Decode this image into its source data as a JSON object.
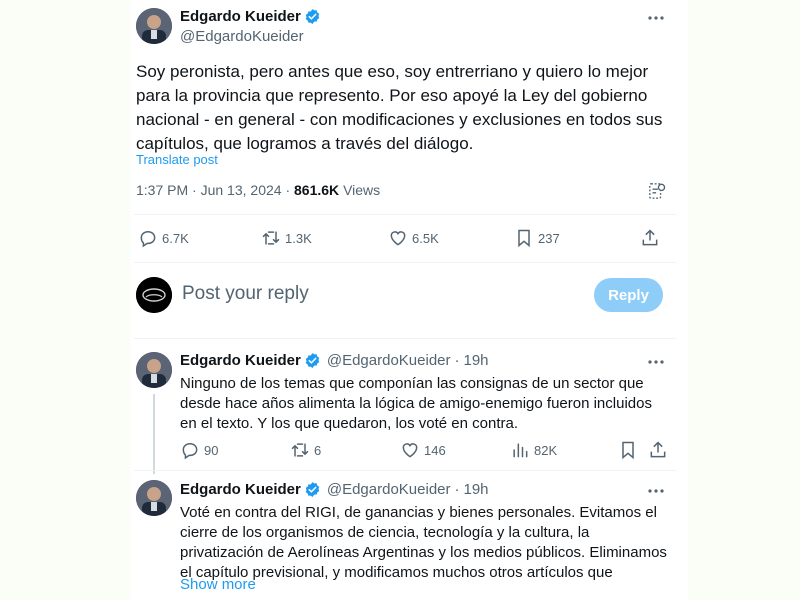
{
  "post": {
    "author_name": "Edgardo Kueider",
    "author_handle": "@EdgardoKueider",
    "text": "Soy peronista, pero antes que eso, soy entrerriano y quiero lo mejor para la provincia que represento. Por eso apoyé la Ley del gobierno nacional - en general - con modificaciones y exclusiones en todos sus capítulos, que logramos a través del diálogo.",
    "translate_label": "Translate post",
    "time": "1:37 PM",
    "date": "Jun 13, 2024",
    "views_count": "861.6K",
    "views_label": "Views",
    "replies": "6.7K",
    "reposts": "1.3K",
    "likes": "6.5K",
    "bookmarks": "237"
  },
  "composer": {
    "placeholder": "Post your reply",
    "button_label": "Reply"
  },
  "replies": [
    {
      "author_name": "Edgardo Kueider",
      "author_handle": "@EdgardoKueider",
      "separator": "·",
      "time": "19h",
      "text": "Ninguno de los temas que componían las consignas de un sector que desde hace años alimenta la lógica de amigo-enemigo fueron incluidos en el texto. Y los que quedaron, los voté en contra.",
      "replies": "90",
      "reposts": "6",
      "likes": "146",
      "views": "82K"
    },
    {
      "author_name": "Edgardo Kueider",
      "author_handle": "@EdgardoKueider",
      "separator": "·",
      "time": "19h",
      "text": "Voté en contra del RIGI, de ganancias y bienes personales. Evitamos el cierre de los organismos de ciencia, tecnología y la cultura, la privatización de Aerolíneas Argentinas y los medios públicos. Eliminamos el capítulo previsional, y modificamos muchos otros artículos que",
      "show_more": "Show more"
    }
  ],
  "colors": {
    "accent": "#1d9bf0",
    "text": "#0f1419",
    "secondary": "#536471",
    "reply_button_disabled": "#8ecdf7"
  }
}
